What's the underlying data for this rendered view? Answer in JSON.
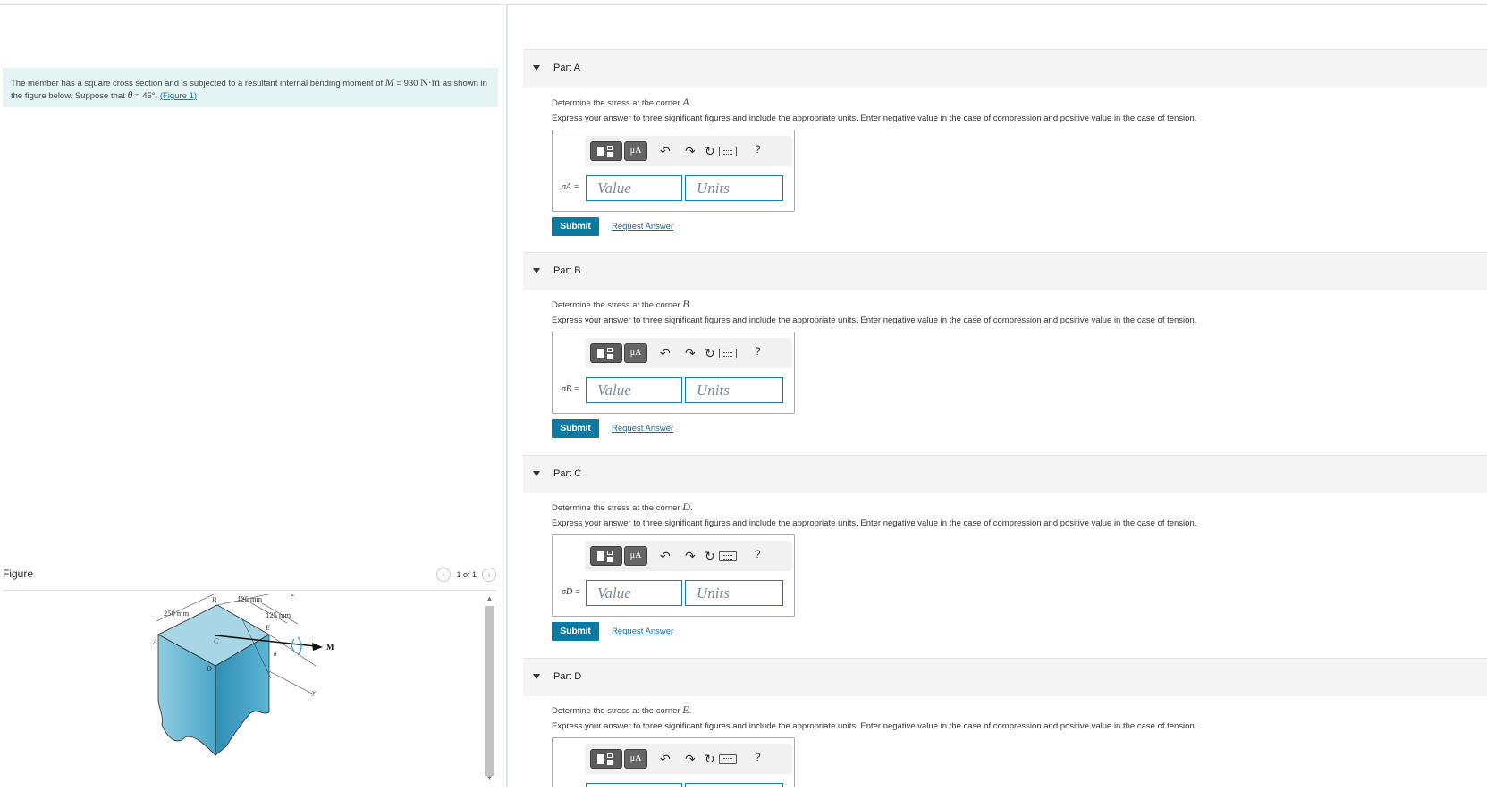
{
  "problem": {
    "text_before": "The member has a square cross section and is subjected to a resultant internal bending moment of ",
    "moment_symbol": "M",
    "moment_eq": " = 930 ",
    "moment_unit": "N·m",
    "text_middle": " as shown in the figure below. Suppose that ",
    "theta": "θ",
    "theta_value": " = 45°. ",
    "figure_link": "(Figure 1)"
  },
  "figure": {
    "heading": "Figure",
    "pager_text": "1 of 1",
    "prev_icon": "chevron-left-icon",
    "next_icon": "chevron-right-icon",
    "labels": {
      "dim_250": "250 mm",
      "dim_125a": "125 mm",
      "dim_125b": "125 mm",
      "A": "A",
      "B": "B",
      "C": "C",
      "D": "D",
      "E": "E",
      "z": "z",
      "y": "y",
      "M": "M",
      "theta": "θ"
    }
  },
  "parts": [
    {
      "title": "Part A",
      "q_prefix": "Determine the stress at the corner ",
      "corner": "A",
      "q_suffix": ".",
      "instruction": "Express your answer to three significant figures and include the appropriate units. Enter negative value in the case of compression and positive value in the case of tension.",
      "symbol": "σA =",
      "value_placeholder": "Value",
      "units_placeholder": "Units",
      "submit": "Submit",
      "request": "Request Answer"
    },
    {
      "title": "Part B",
      "q_prefix": "Determine the stress at the corner ",
      "corner": "B",
      "q_suffix": ".",
      "instruction": "Express your answer to three significant figures and include the appropriate units. Enter negative value in the case of compression and positive value in the case of tension.",
      "symbol": "σB =",
      "value_placeholder": "Value",
      "units_placeholder": "Units",
      "submit": "Submit",
      "request": "Request Answer"
    },
    {
      "title": "Part C",
      "q_prefix": "Determine the stress at the corner ",
      "corner": "D",
      "q_suffix": ".",
      "instruction": "Express your answer to three significant figures and include the appropriate units. Enter negative value in the case of compression and positive value in the case of tension.",
      "symbol": "σD =",
      "value_placeholder": "Value",
      "units_placeholder": "Units",
      "submit": "Submit",
      "request": "Request Answer"
    },
    {
      "title": "Part D",
      "q_prefix": "Determine the stress at the corner ",
      "corner": "E",
      "q_suffix": ".",
      "instruction": "Express your answer to three significant figures and include the appropriate units. Enter negative value in the case of compression and positive value in the case of tension.",
      "symbol": "",
      "value_placeholder": "",
      "units_placeholder": "",
      "submit": "",
      "request": ""
    }
  ],
  "toolbar": {
    "templates_icon": "templates-icon",
    "mu_label": "μA",
    "undo_icon": "undo-icon",
    "redo_icon": "redo-icon",
    "reset_icon": "reset-icon",
    "keyboard_icon": "keyboard-icon",
    "help_label": "?"
  },
  "colors": {
    "accent": "#0b7aa1",
    "problem_bg": "#e4f3f4",
    "link": "#1a7bb0",
    "part_header_bg": "#f5f5f5"
  }
}
